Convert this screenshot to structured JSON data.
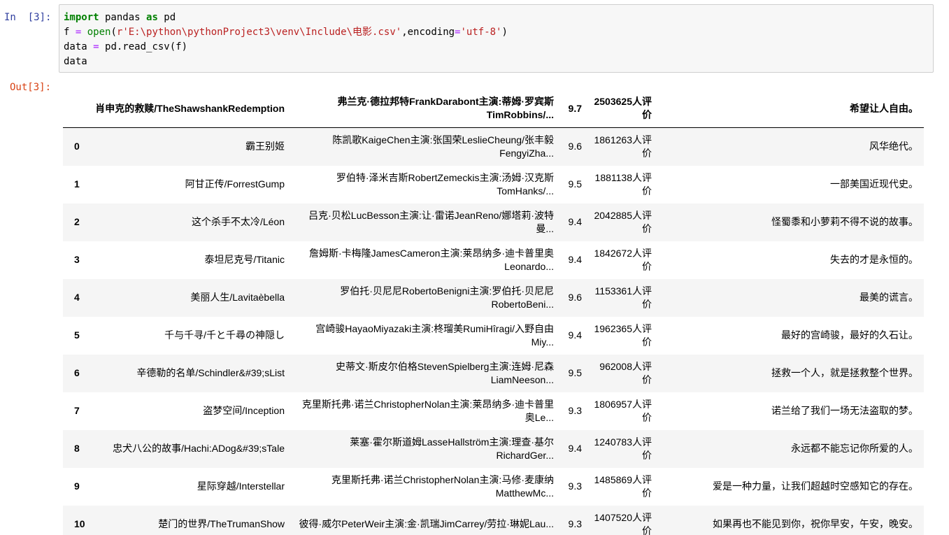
{
  "in_prompt": "In  [3]:",
  "out_prompt": "Out[3]:",
  "code": {
    "line1": {
      "kw1": "import",
      "mid": " pandas ",
      "kw2": "as",
      "end": " pd"
    },
    "line2": {
      "lhs": "f ",
      "eq": "=",
      "sp": " ",
      "fn": "open",
      "open_paren": "(",
      "path": "r'E:\\python\\pythonProject3\\venv\\Include\\电影.csv'",
      "comma": ",encoding",
      "eq2": "=",
      "enc": "'utf-8'",
      "close": ")"
    },
    "line3": {
      "lhs": "data ",
      "eq": "=",
      "rhs": " pd.read_csv(f)"
    },
    "line4": "data"
  },
  "table": {
    "header": [
      "",
      "肖申克的救赎/TheShawshankRedemption",
      "弗兰克·德拉邦特FrankDarabont主演:蒂姆·罗宾斯TimRobbins/...",
      "9.7",
      "2503625人评价",
      "希望让人自由。"
    ],
    "rows": [
      {
        "index": "0",
        "title": "霸王别姬",
        "crew": "陈凯歌KaigeChen主演:张国荣LeslieCheung/张丰毅FengyiZha...",
        "score": "9.6",
        "votes": "1861263人评价",
        "quote": "风华绝代。"
      },
      {
        "index": "1",
        "title": "阿甘正传/ForrestGump",
        "crew": "罗伯特·泽米吉斯RobertZemeckis主演:汤姆·汉克斯TomHanks/...",
        "score": "9.5",
        "votes": "1881138人评价",
        "quote": "一部美国近现代史。"
      },
      {
        "index": "2",
        "title": "这个杀手不太冷/Léon",
        "crew": "吕克·贝松LucBesson主演:让·雷诺JeanReno/娜塔莉·波特曼...",
        "score": "9.4",
        "votes": "2042885人评价",
        "quote": "怪蜀黍和小萝莉不得不说的故事。"
      },
      {
        "index": "3",
        "title": "泰坦尼克号/Titanic",
        "crew": "詹姆斯·卡梅隆JamesCameron主演:莱昂纳多·迪卡普里奥Leonardo...",
        "score": "9.4",
        "votes": "1842672人评价",
        "quote": "失去的才是永恒的。"
      },
      {
        "index": "4",
        "title": "美丽人生/Lavitaèbella",
        "crew": "罗伯托·贝尼尼RobertoBenigni主演:罗伯托·贝尼尼RobertoBeni...",
        "score": "9.6",
        "votes": "1153361人评价",
        "quote": "最美的谎言。"
      },
      {
        "index": "5",
        "title": "千与千寻/千と千尋の神隠し",
        "crew": "宫崎骏HayaoMiyazaki主演:柊瑠美RumiHîragi/入野自由Miy...",
        "score": "9.4",
        "votes": "1962365人评价",
        "quote": "最好的宫崎骏，最好的久石让。"
      },
      {
        "index": "6",
        "title": "辛德勒的名单/Schindler&#39;sList",
        "crew": "史蒂文·斯皮尔伯格StevenSpielberg主演:连姆·尼森LiamNeeson...",
        "score": "9.5",
        "votes": "962008人评价",
        "quote": "拯救一个人，就是拯救整个世界。"
      },
      {
        "index": "7",
        "title": "盗梦空间/Inception",
        "crew": "克里斯托弗·诺兰ChristopherNolan主演:莱昂纳多·迪卡普里奥Le...",
        "score": "9.3",
        "votes": "1806957人评价",
        "quote": "诺兰给了我们一场无法盗取的梦。"
      },
      {
        "index": "8",
        "title": "忠犬八公的故事/Hachi:ADog&#39;sTale",
        "crew": "莱塞·霍尔斯道姆LasseHallström主演:理查·基尔RichardGer...",
        "score": "9.4",
        "votes": "1240783人评价",
        "quote": "永远都不能忘记你所爱的人。"
      },
      {
        "index": "9",
        "title": "星际穿越/Interstellar",
        "crew": "克里斯托弗·诺兰ChristopherNolan主演:马修·麦康纳MatthewMc...",
        "score": "9.3",
        "votes": "1485869人评价",
        "quote": "爱是一种力量，让我们超越时空感知它的存在。"
      },
      {
        "index": "10",
        "title": "楚门的世界/TheTrumanShow",
        "crew": "彼得·威尔PeterWeir主演:金·凯瑞JimCarrey/劳拉·琳妮Lau...",
        "score": "9.3",
        "votes": "1407520人评价",
        "quote": "如果再也不能见到你，祝你早安，午安，晚安。"
      }
    ]
  }
}
